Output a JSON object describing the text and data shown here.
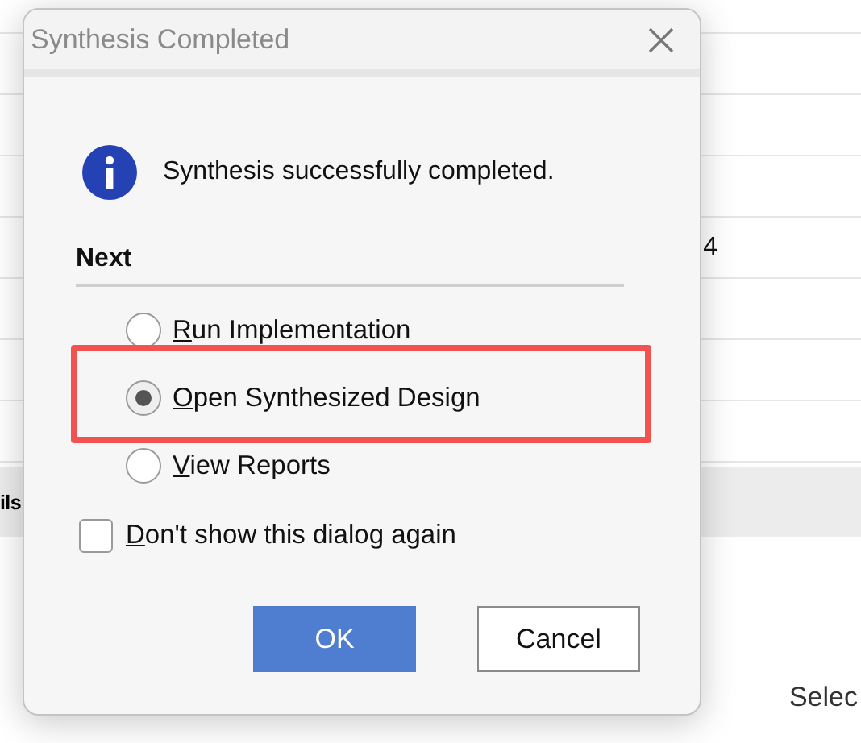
{
  "background": {
    "rows": [
      {
        "text": "4"
      }
    ],
    "band_text": "ils",
    "corner_text": "Selec"
  },
  "dialog": {
    "title": "Synthesis Completed",
    "message": "Synthesis successfully completed.",
    "section_title": "Next",
    "options": [
      {
        "label": "Run Implementation",
        "selected": false,
        "highlighted": false,
        "underline_first": true
      },
      {
        "label": "Open Synthesized Design",
        "selected": true,
        "highlighted": true,
        "underline_first": true
      },
      {
        "label": "View Reports",
        "selected": false,
        "highlighted": false,
        "underline_first": true
      }
    ],
    "checkbox": {
      "label": "Don't show this dialog again",
      "checked": false,
      "underline_first": true
    },
    "buttons": [
      {
        "label": "OK",
        "kind": "primary"
      },
      {
        "label": "Cancel",
        "kind": "secondary"
      }
    ]
  }
}
